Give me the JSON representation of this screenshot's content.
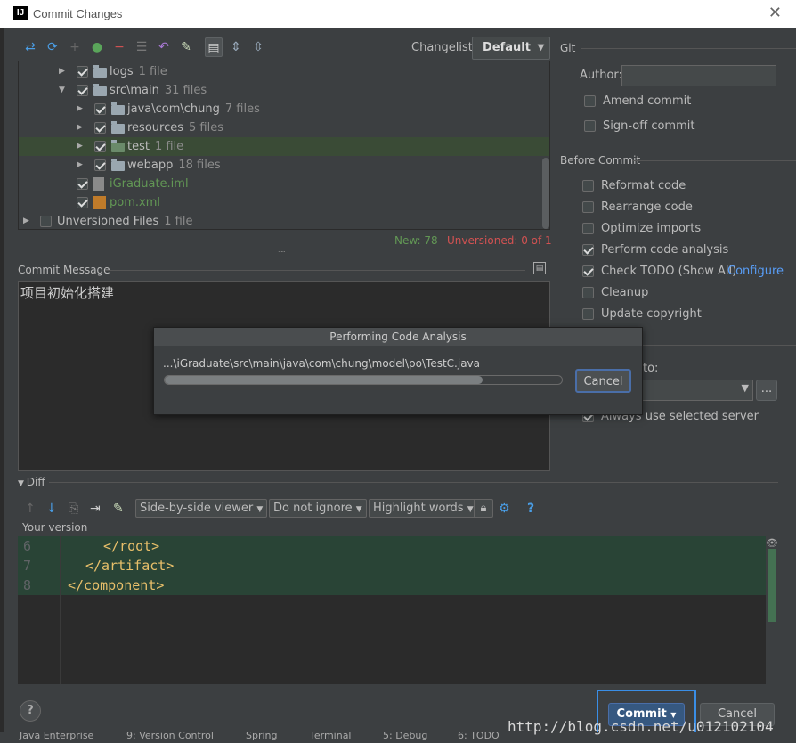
{
  "window": {
    "title": "Commit Changes",
    "logo": "IJ"
  },
  "changelist": {
    "label": "Changelist:",
    "value": "Default"
  },
  "tree": {
    "rows": [
      {
        "name": "logs",
        "count": "1 file"
      },
      {
        "name": "src\\main",
        "count": "31 files"
      },
      {
        "name": "java\\com\\chung",
        "count": "7 files"
      },
      {
        "name": "resources",
        "count": "5 files"
      },
      {
        "name": "test",
        "count": "1 file"
      },
      {
        "name": "webapp",
        "count": "18 files"
      },
      {
        "name": "iGraduate.iml",
        "count": ""
      },
      {
        "name": "pom.xml",
        "count": ""
      },
      {
        "name": "Unversioned Files",
        "count": "1 file"
      }
    ],
    "status_new": "New: 78",
    "status_unversioned": "Unversioned: 0 of 1"
  },
  "commit_message": {
    "label": "Commit Message",
    "text": "项目初始化搭建"
  },
  "git": {
    "section": "Git",
    "author_label": "Author:",
    "author_value": "",
    "amend": "Amend commit",
    "signoff": "Sign-off commit"
  },
  "before_commit": {
    "section": "Before Commit",
    "options": [
      "Reformat code",
      "Rearrange code",
      "Optimize imports",
      "Perform code analysis",
      "Check TODO (Show All)",
      "Cleanup",
      "Update copyright"
    ],
    "configure": "Configure",
    "checked": [
      false,
      false,
      false,
      true,
      true,
      false,
      false
    ]
  },
  "after_commit": {
    "partial_label": "to:",
    "always_use": "Always use selected server",
    "more": "..."
  },
  "dialog": {
    "title": "Performing Code Analysis",
    "path": "...\\iGraduate\\src\\main\\java\\com\\chung\\model\\po\\TestC.java",
    "cancel": "Cancel",
    "progress": 0.8
  },
  "diff": {
    "label": "Diff",
    "viewer": "Side-by-side viewer",
    "ignore": "Do not ignore",
    "highlight": "Highlight words",
    "your_version": "Your version",
    "lines": [
      {
        "num": "6",
        "text": "</root>"
      },
      {
        "num": "7",
        "text": "</artifact>"
      },
      {
        "num": "8",
        "text": "</component>"
      }
    ]
  },
  "footer": {
    "commit": "Commit",
    "cancel": "Cancel",
    "help": "?"
  },
  "statusbar": [
    "Java Enterprise",
    "9: Version Control",
    "Spring",
    "Terminal",
    "5: Debug",
    "6: TODO"
  ],
  "watermark": "http://blog.csdn.net/u012102104",
  "colors": {
    "accent": "#365880",
    "added": "#629755",
    "unversioned": "#d25252",
    "link": "#589df6"
  }
}
